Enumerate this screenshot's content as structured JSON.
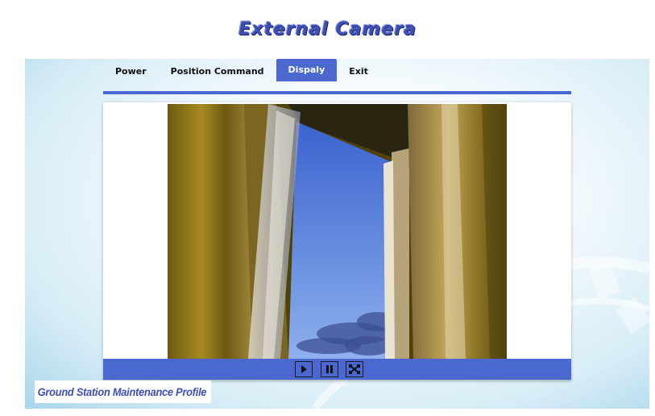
{
  "header": {
    "title": "External Camera"
  },
  "nav": {
    "items": [
      {
        "label": "Power"
      },
      {
        "label": "Position Command"
      },
      {
        "label": "Dispaly",
        "active": true
      },
      {
        "label": "Exit"
      }
    ]
  },
  "controls": {
    "buttons": [
      {
        "icon": "play-icon"
      },
      {
        "icon": "pause-icon"
      },
      {
        "icon": "fullscreen-icon"
      }
    ]
  },
  "footer": {
    "profile": "Ground Station Maintenance Profile"
  },
  "colors": {
    "accent": "#4a68cf",
    "title": "#3e4fb1"
  }
}
